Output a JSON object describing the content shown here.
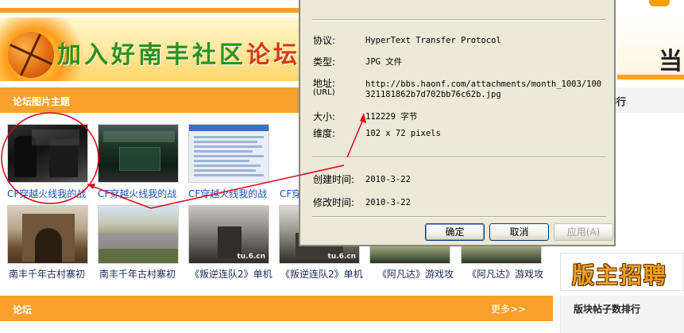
{
  "banner": {
    "title_green": "加入好南丰社区",
    "title_red": "论坛",
    "right_glyph": "当"
  },
  "sections": {
    "pics_title": "论坛图片主题",
    "forum_title": "论坛",
    "forum_more": "更多>>",
    "side_rank_title": "排行",
    "recruit_text": "版主招聘",
    "side_post_rank_title": "版块帖子数排行"
  },
  "thumbnails": [
    {
      "caption": "CF穿越火线我的战"
    },
    {
      "caption": "CF穿越火线我的战"
    },
    {
      "caption": "CF穿越火线我的战"
    },
    {
      "caption": "CF穿"
    },
    {
      "caption": "南丰千年古村寨初"
    },
    {
      "caption": "南丰千年古村寨初"
    },
    {
      "caption": "《叛逆连队2》单机"
    },
    {
      "caption": "《叛逆连队2》单机"
    },
    {
      "caption": "《阿凡达》游戏攻"
    },
    {
      "caption": "《阿凡达》游戏攻"
    }
  ],
  "thumb_watermark": "tu.6.cn",
  "dialog": {
    "protocol_label": "协议:",
    "protocol_value": "HyperText Transfer Protocol",
    "type_label": "类型:",
    "type_value": "JPG 文件",
    "address_label": "地址:",
    "address_label_sub": "(URL)",
    "address_line1": "http://bbs.haonf.com/attachments/month_1003/100",
    "address_line2": "321181862b7d702bb76c62b.jpg",
    "size_label": "大小:",
    "size_value": "112229 字节",
    "dimension_label": "维度:",
    "dimension_value": "102  x  72  pixels",
    "created_label": "创建时间:",
    "created_value": "2010-3-22",
    "modified_label": "修改时间:",
    "modified_value": "2010-3-22",
    "ok_label": "确定",
    "cancel_label": "取消",
    "apply_label": "应用(A)"
  },
  "colors": {
    "section_orange": "#f9a02b",
    "dialog_face": "#ece9d8",
    "annotation_red": "#e0001a",
    "caption_blue": "#1f4fa8"
  }
}
